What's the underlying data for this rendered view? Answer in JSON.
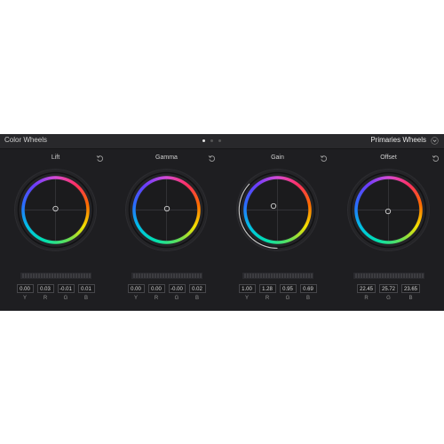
{
  "header": {
    "title": "Color Wheels",
    "mode": "Primaries Wheels"
  },
  "wheels": [
    {
      "label": "Lift",
      "values": [
        "0.00",
        "0.03",
        "-0.01",
        "0.01"
      ],
      "channels": [
        "Y",
        "R",
        "G",
        "B"
      ]
    },
    {
      "label": "Gamma",
      "values": [
        "0.00",
        "0.00",
        "-0.00",
        "0.02"
      ],
      "channels": [
        "Y",
        "R",
        "G",
        "B"
      ]
    },
    {
      "label": "Gain",
      "values": [
        "1.00",
        "1.28",
        "0.95",
        "0.69"
      ],
      "channels": [
        "Y",
        "R",
        "G",
        "B"
      ]
    },
    {
      "label": "Offset",
      "values": [
        "22.45",
        "25.72",
        "23.65"
      ],
      "channels": [
        "R",
        "G",
        "B"
      ]
    }
  ]
}
